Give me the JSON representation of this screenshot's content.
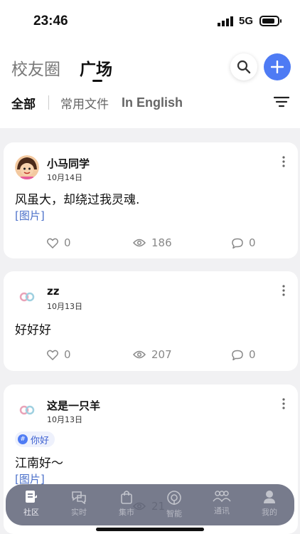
{
  "status_bar": {
    "time": "23:46",
    "network": "5G"
  },
  "header": {
    "tabs": [
      {
        "label": "校友圈",
        "active": false
      },
      {
        "label": "广场",
        "active": true
      }
    ],
    "subtabs": [
      {
        "label": "全部",
        "active": true
      },
      {
        "label": "常用文件",
        "active": false
      },
      {
        "label": "In English",
        "active": false
      }
    ],
    "icons": {
      "search": "search-icon",
      "add": "plus-icon",
      "filter": "filter-icon"
    },
    "accent": "#4e7bf4"
  },
  "posts": [
    {
      "author": "小马同学",
      "date": "10月14日",
      "content": "风虽大，却绕过我灵魂.",
      "image_tag": "[图片]",
      "likes": "0",
      "views": "186",
      "comments": "0"
    },
    {
      "author": "zz",
      "date": "10月13日",
      "content": "好好好",
      "likes": "0",
      "views": "207",
      "comments": "0"
    },
    {
      "author": "这是一只羊",
      "date": "10月13日",
      "topic": "你好",
      "content": "江南好～",
      "image_tag": "[图片]",
      "views": "21"
    }
  ],
  "bottom_nav": [
    {
      "label": "社区",
      "icon": "community-icon",
      "active": true
    },
    {
      "label": "实时",
      "icon": "chat-icon",
      "active": false
    },
    {
      "label": "集市",
      "icon": "shopping-bag-icon",
      "active": false
    },
    {
      "label": "智能",
      "icon": "ai-icon",
      "active": false
    },
    {
      "label": "通讯",
      "icon": "contacts-icon",
      "active": false
    },
    {
      "label": "我的",
      "icon": "profile-icon",
      "active": false
    }
  ]
}
